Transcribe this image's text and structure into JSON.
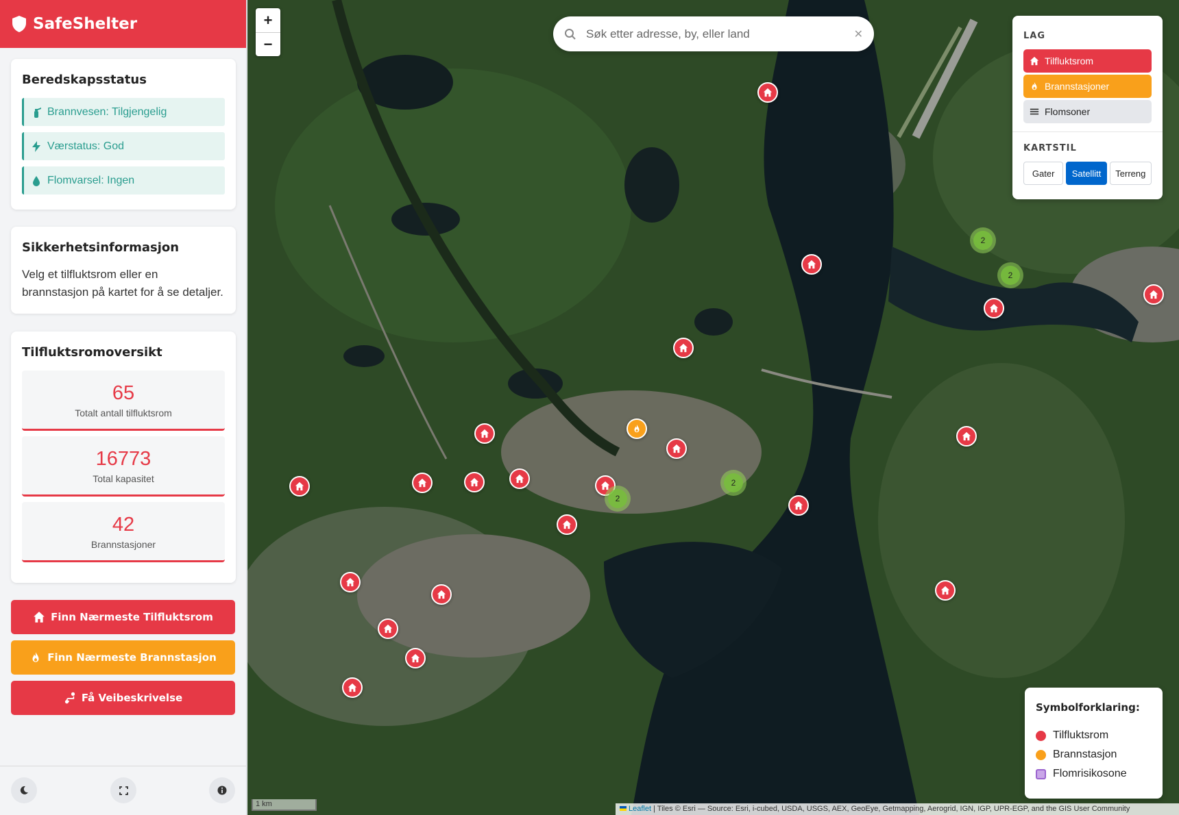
{
  "app": {
    "title": "SafeShelter"
  },
  "readiness": {
    "title": "Beredskapsstatus",
    "items": [
      {
        "label": "Brannvesen: Tilgjengelig",
        "icon": "fire-extinguisher-icon"
      },
      {
        "label": "Værstatus: God",
        "icon": "bolt-icon"
      },
      {
        "label": "Flomvarsel: Ingen",
        "icon": "droplet-icon"
      }
    ]
  },
  "safety_info": {
    "title": "Sikkerhetsinformasjon",
    "text": "Velg et tilfluktsrom eller en brannstasjon på kartet for å se detaljer."
  },
  "overview": {
    "title": "Tilfluktsromoversikt",
    "stats": [
      {
        "value": "65",
        "label": "Totalt antall tilfluktsrom"
      },
      {
        "value": "16773",
        "label": "Total kapasitet"
      },
      {
        "value": "42",
        "label": "Brannstasjoner"
      }
    ]
  },
  "actions": {
    "nearest_shelter": "Finn Nærmeste Tilfluktsrom",
    "nearest_firestation": "Finn Nærmeste Brannstasjon",
    "directions": "Få Veibeskrivelse"
  },
  "search": {
    "placeholder": "Søk etter adresse, by, eller land",
    "value": ""
  },
  "zoom": {
    "in": "+",
    "out": "−"
  },
  "layers_panel": {
    "title": "LAG",
    "layers": [
      {
        "label": "Tilfluktsrom",
        "active": true
      },
      {
        "label": "Brannstasjoner",
        "active": true
      },
      {
        "label": "Flomsoner",
        "active": false
      }
    ],
    "style_title": "KARTSTIL",
    "styles": [
      "Gater",
      "Satellitt",
      "Terreng"
    ],
    "active_style": "Satellitt"
  },
  "legend": {
    "title": "Symbolforklaring:",
    "items": [
      {
        "label": "Tilfluktsrom",
        "color": "#e63946"
      },
      {
        "label": "Brannstasjon",
        "color": "#f9a01b"
      },
      {
        "label": "Flomrisikosone",
        "color": "#b07ad8"
      }
    ]
  },
  "map": {
    "cluster_count": "2",
    "scale_label": "1 km",
    "attribution_link": "Leaflet",
    "attribution_text": " | Tiles © Esri — Source: Esri, i-cubed, USDA, USGS, AEX, GeoEye, Getmapping, Aerogrid, IGN, IGP, UPR-EGP, and the GIS User Community"
  },
  "colors": {
    "primary": "#e63946",
    "secondary": "#f9a01b",
    "status": "#2a9d8f",
    "active_style": "#0066cc"
  }
}
